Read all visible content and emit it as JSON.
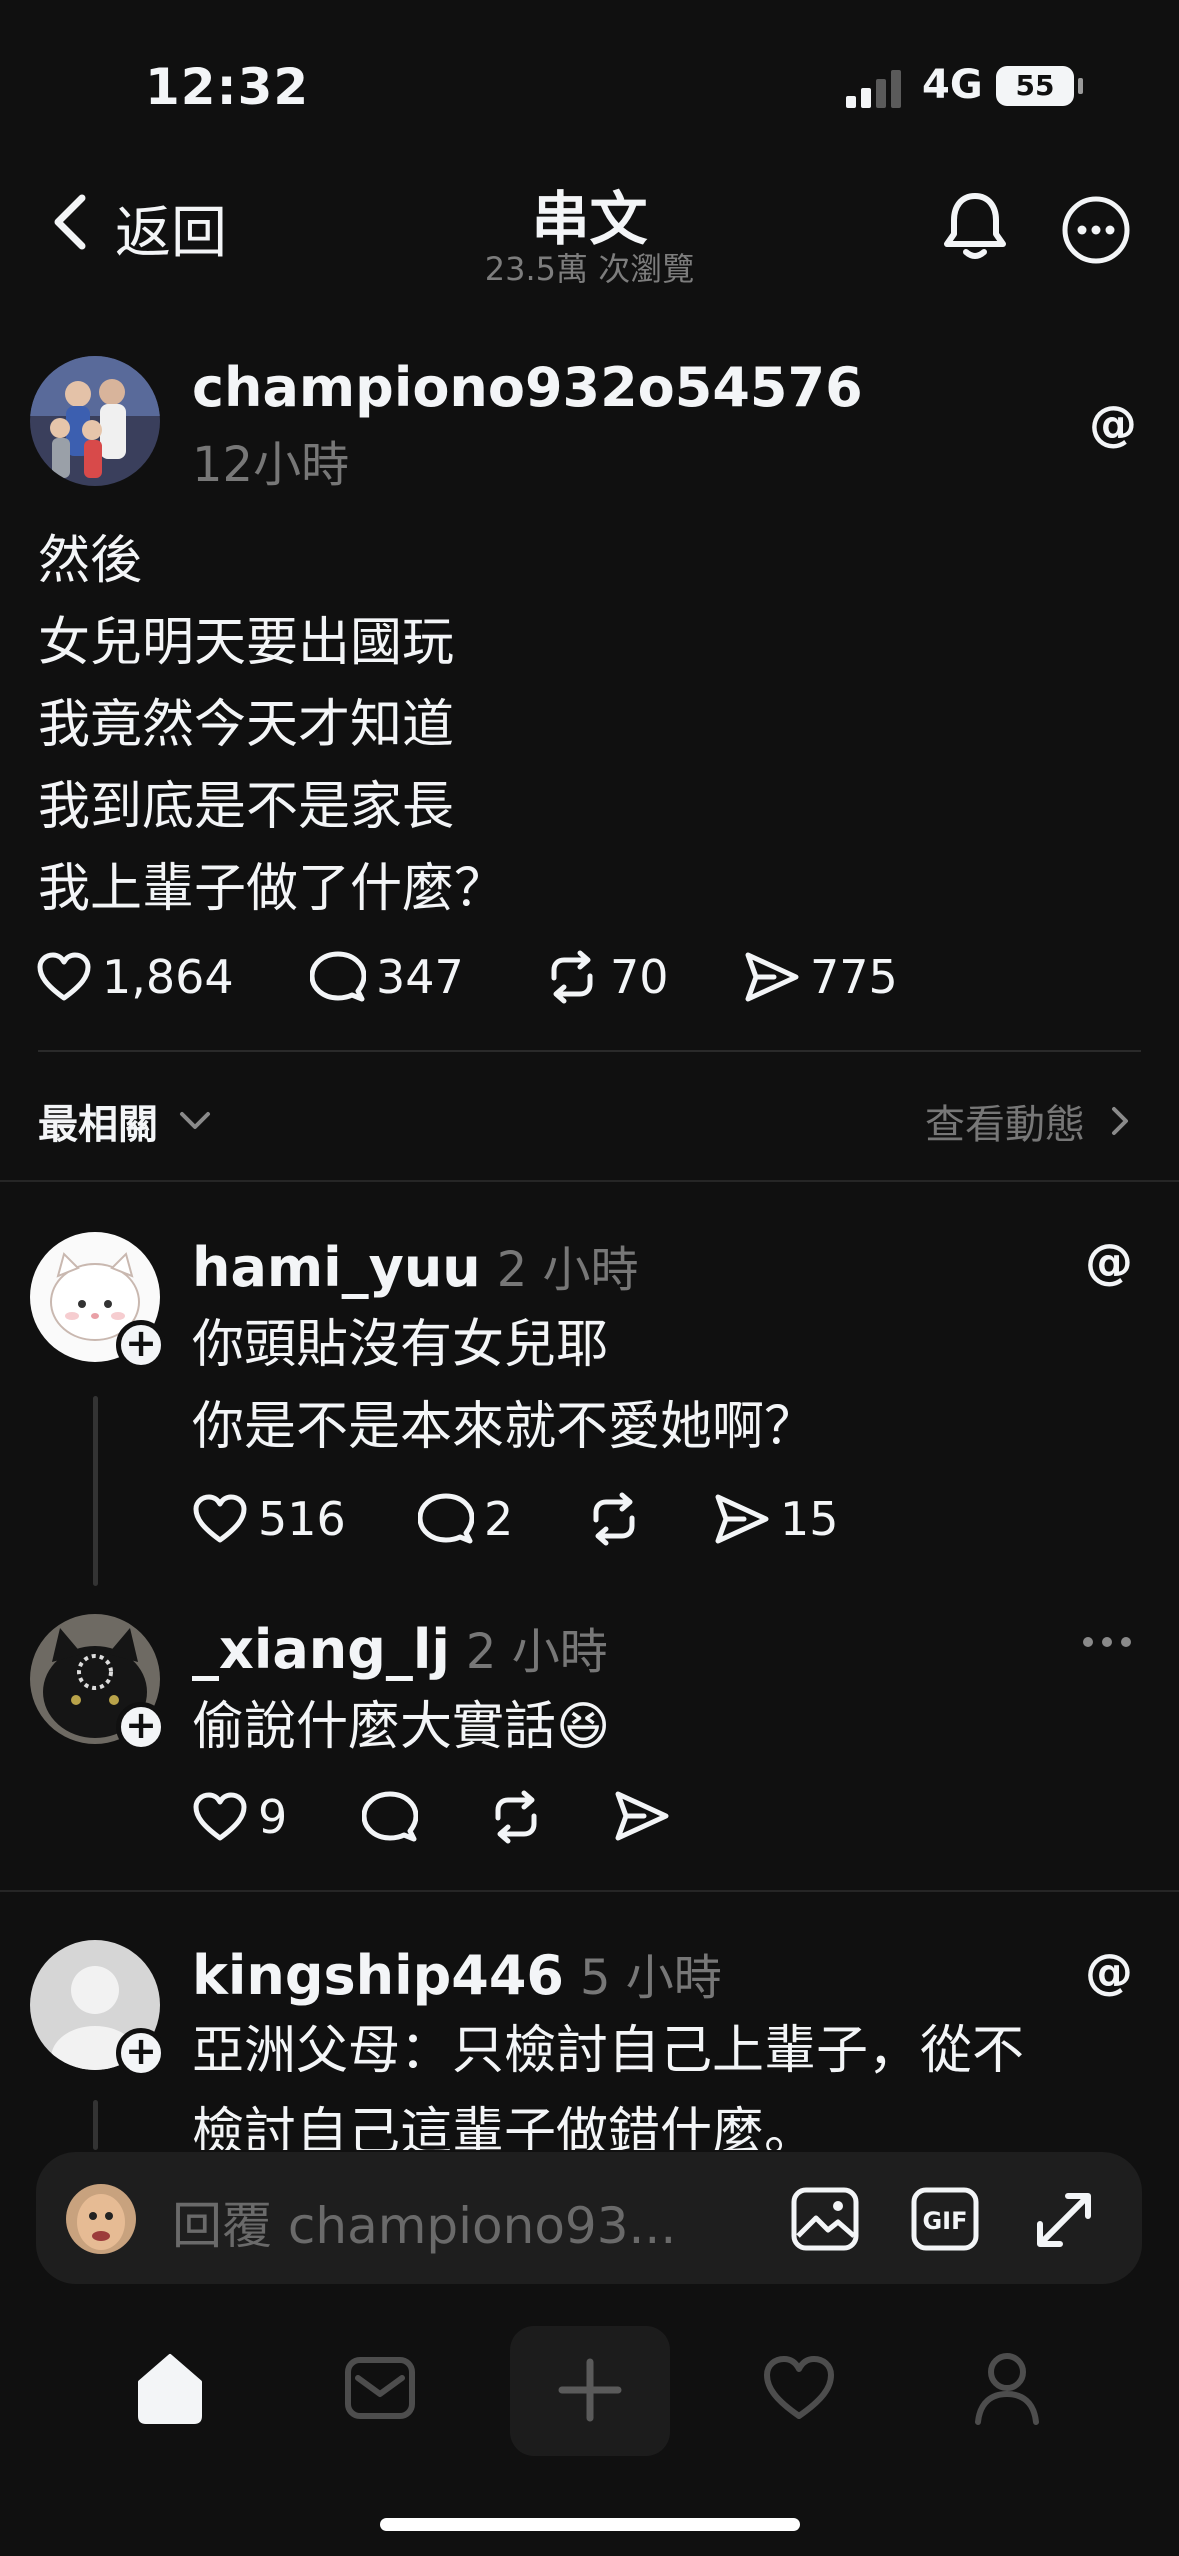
{
  "status_bar": {
    "time": "12:32",
    "network": "4G",
    "battery": "55"
  },
  "nav": {
    "back_label": "返回",
    "title": "串文",
    "views": "23.5萬 次瀏覽"
  },
  "post": {
    "username": "championo932o54576",
    "time": "12小時",
    "lines": [
      "然後",
      "女兒明天要出國玩",
      "我竟然今天才知道",
      "我到底是不是家長",
      "我上輩子做了什麼？"
    ],
    "likes": "1,864",
    "comments": "347",
    "reposts": "70",
    "shares": "775"
  },
  "sort": {
    "label": "最相關",
    "activity_label": "查看動態"
  },
  "replies": [
    {
      "username": "hami_yuu",
      "time": "2 小時",
      "lines": [
        "你頭貼沒有女兒耶",
        "你是不是本來就不愛她啊？"
      ],
      "likes": "516",
      "comments": "2",
      "shares": "15"
    },
    {
      "username": "_xiang_lj",
      "time": "2 小時",
      "lines": [
        "偷說什麼大實話😆"
      ],
      "likes": "9"
    },
    {
      "username": "kingship446",
      "time": "5 小時",
      "lines": [
        "亞洲父母：只檢討自己上輩子，從不",
        "檢討自己這輩子做錯什麼。"
      ]
    }
  ],
  "composer": {
    "placeholder": "回覆 championo93..."
  },
  "icons": {
    "accent": "#f3f5f7",
    "background": "#101010",
    "muted": "#777777"
  }
}
